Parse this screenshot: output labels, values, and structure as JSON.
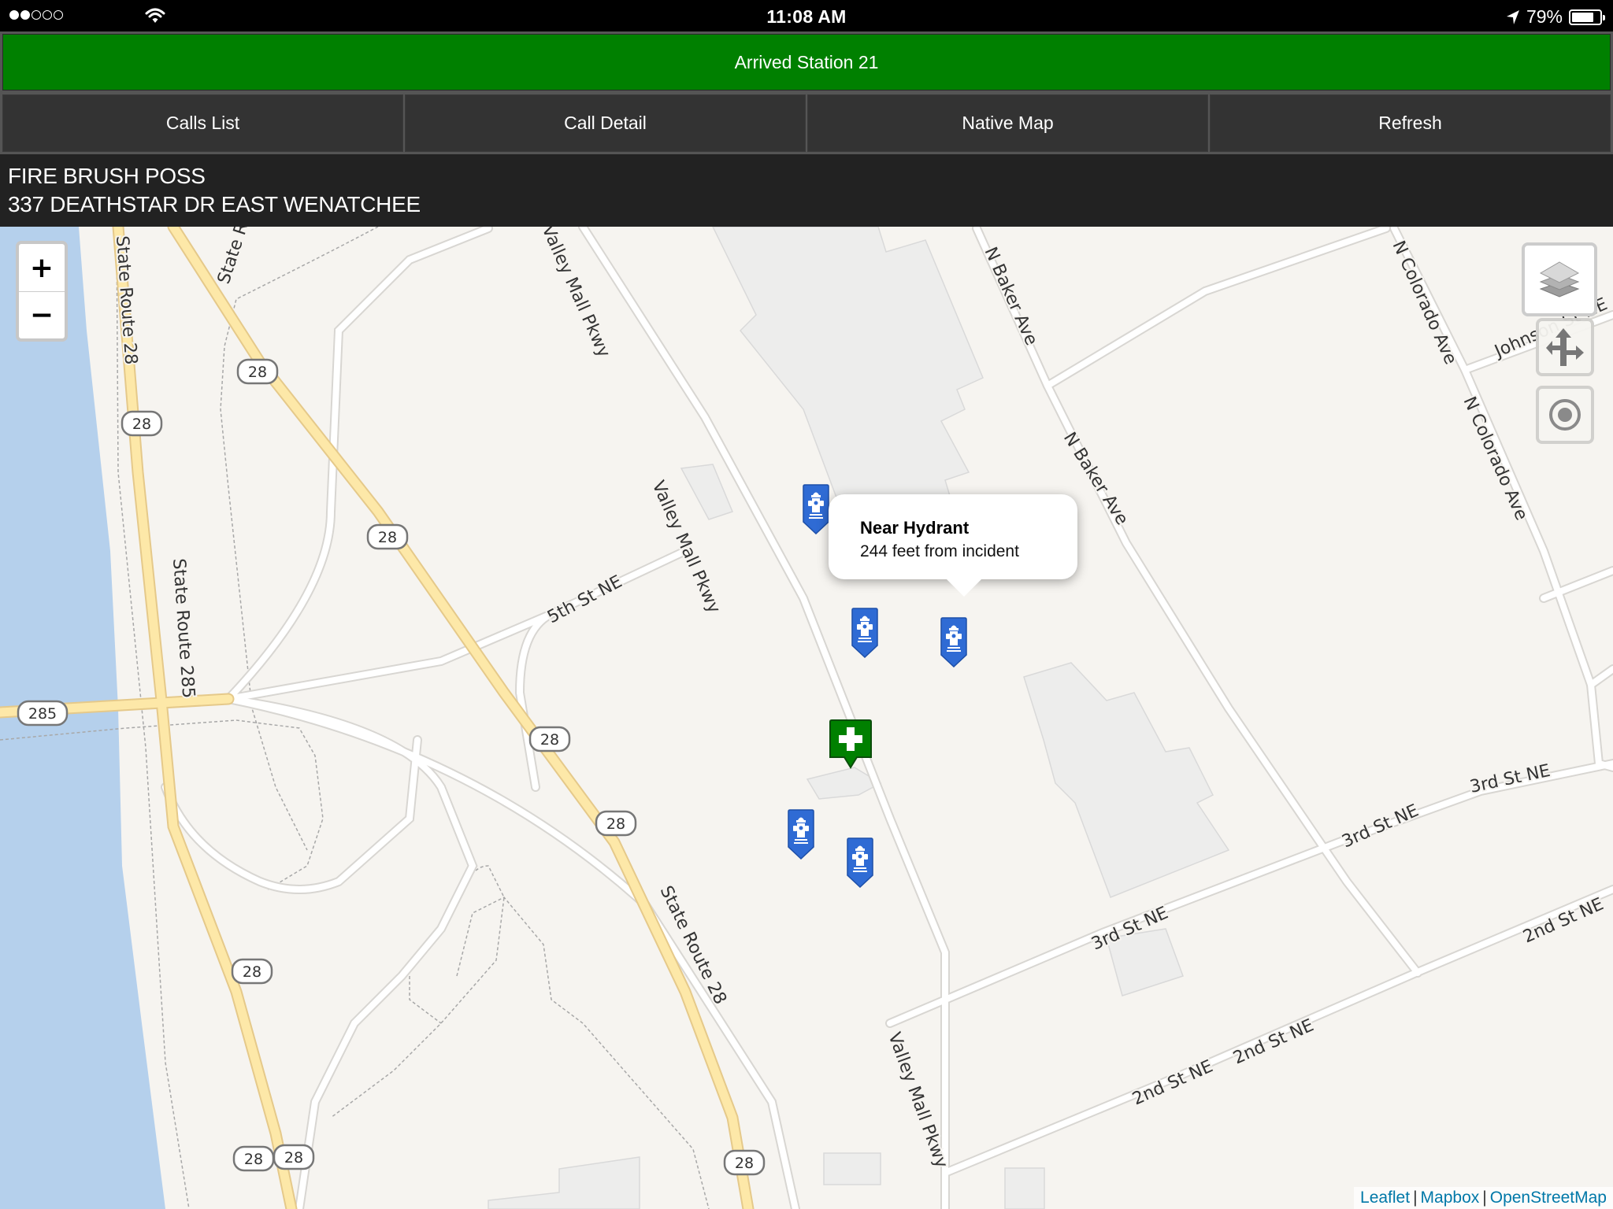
{
  "status_bar": {
    "signal": {
      "filled": 2,
      "total": 5
    },
    "time": "11:08 AM",
    "battery_percent": "79%",
    "battery_level": 0.79,
    "icons": [
      "signal-dots-icon",
      "wifi-icon",
      "location-arrow-icon",
      "battery-icon"
    ]
  },
  "banner": {
    "status": "Arrived Station 21",
    "color": "#008000"
  },
  "nav": {
    "buttons": [
      {
        "label": "Calls List"
      },
      {
        "label": "Call Detail"
      },
      {
        "label": "Native Map"
      },
      {
        "label": "Refresh"
      }
    ]
  },
  "incident": {
    "type": "FIRE BRUSH POSS",
    "address": "337 DEATHSTAR DR EAST WENATCHEE"
  },
  "map": {
    "controls": {
      "zoom_in": "+",
      "zoom_out": "−",
      "layers_icon": "layers-icon",
      "directions_icon": "directions-icon",
      "locate_icon": "locate-icon"
    },
    "popup": {
      "title": "Near Hydrant",
      "body": "244 feet from incident"
    },
    "markers": {
      "incident": {
        "type": "incident",
        "icon": "plus-icon",
        "color": "#008000"
      },
      "hydrants": [
        {
          "type": "hydrant",
          "icon": "hydrant-icon",
          "color": "#2f6bd4"
        },
        {
          "type": "hydrant",
          "icon": "hydrant-icon",
          "color": "#2f6bd4"
        },
        {
          "type": "hydrant",
          "icon": "hydrant-icon",
          "color": "#2f6bd4",
          "selected": true
        },
        {
          "type": "hydrant",
          "icon": "hydrant-icon",
          "color": "#2f6bd4"
        },
        {
          "type": "hydrant",
          "icon": "hydrant-icon",
          "color": "#2f6bd4"
        }
      ]
    },
    "street_labels": {
      "sr28_a": "State Route 28",
      "sr28_b": "State Route 28",
      "state_r": "State R",
      "sr285": "State Route 285",
      "valley_mall_1": "Valley Mall Pkwy",
      "valley_mall_2": "Valley Mall Pkwy",
      "valley_mall_3": "Valley Mall Pkwy",
      "fifth_st": "5th St NE",
      "baker_1": "N Baker Ave",
      "baker_2": "N Baker Ave",
      "colorado_1": "N Colorado Ave",
      "colorado_2": "N Colorado Ave",
      "johnson": "Johnson St NE",
      "third_1": "3rd St NE",
      "third_2": "3rd St NE",
      "third_3": "3rd St NE",
      "second_1": "2nd St NE",
      "second_2": "2nd St NE",
      "second_3": "2nd St NE"
    },
    "shields": [
      "28",
      "28",
      "28",
      "28",
      "28",
      "28",
      "28",
      "28",
      "28",
      "285"
    ],
    "attribution": {
      "links": [
        "Leaflet",
        "Mapbox",
        "OpenStreetMap"
      ],
      "separator": "|"
    }
  }
}
